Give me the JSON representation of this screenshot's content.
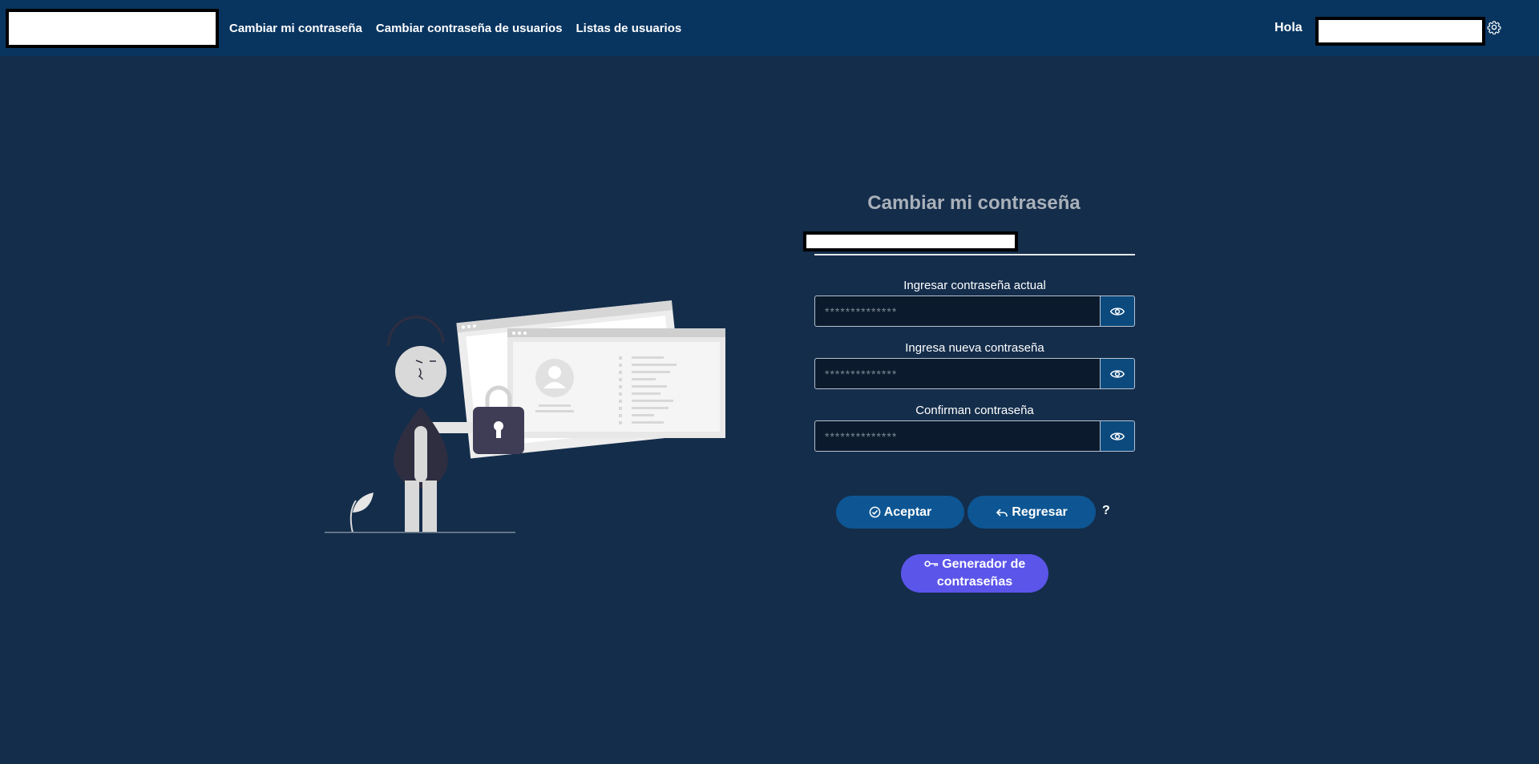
{
  "nav": {
    "links": [
      "Cambiar mi contraseña",
      "Cambiar contraseña de usuarios",
      "Listas de usuarios"
    ],
    "greeting": "Hola",
    "icons": {
      "settings": "gear-icon"
    }
  },
  "form": {
    "title": "Cambiar mi contraseña",
    "fields": [
      {
        "label": "Ingresar contraseña actual",
        "placeholder": "**************"
      },
      {
        "label": "Ingresa nueva contraseña",
        "placeholder": "**************"
      },
      {
        "label": "Confirman contraseña",
        "placeholder": "**************"
      }
    ],
    "accept_label": "Aceptar",
    "back_label": "Regresar",
    "help_label": "?",
    "generator_label": "Generador de contraseñas",
    "icons": {
      "toggle": "eye-icon",
      "accept": "check-circle-icon",
      "back": "undo-arrow-icon",
      "generator": "key-icon"
    }
  },
  "colors": {
    "background": "#142d4b",
    "navbar": "#083560",
    "primary_button": "#0d5693",
    "generator_button": "#5b55ea"
  }
}
